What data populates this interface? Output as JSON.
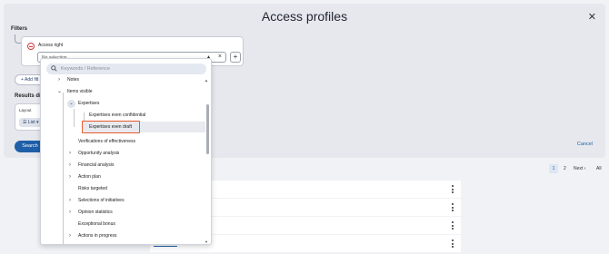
{
  "modal": {
    "title": "Access profiles",
    "close_icon": "close-icon"
  },
  "filters": {
    "label": "Filters",
    "access_right_label": "Access right",
    "select_placeholder": "No selection",
    "add_filter_label": "+ Add filt",
    "plus_label": "+"
  },
  "results": {
    "label": "Results disp",
    "layout_label": "Layout",
    "list_label": "☰ List ▾"
  },
  "buttons": {
    "search": "Search",
    "cancel": "Cancel"
  },
  "pagination": {
    "current": "1",
    "page2": "2",
    "next": "Next ›",
    "all": "All"
  },
  "dropdown": {
    "search_placeholder": "Keywords / Reference",
    "items": [
      {
        "label": "Notes"
      },
      {
        "label": "Items visible"
      },
      {
        "label": "Expertises"
      },
      {
        "label": "Expertises even confidential"
      },
      {
        "label": "Expertises even draft"
      },
      {
        "label": "Verifications of effectiveness"
      },
      {
        "label": "Opportunity analysis"
      },
      {
        "label": "Financial analysis"
      },
      {
        "label": "Action plan"
      },
      {
        "label": "Risks targeted"
      },
      {
        "label": "Selections of initiatives"
      },
      {
        "label": "Opinion statistics"
      },
      {
        "label": "Exceptional bonus"
      },
      {
        "label": "Actions in progress"
      }
    ]
  },
  "result_rows": {
    "partial_link": "Global draft"
  },
  "colors": {
    "primary": "#1e5fa8",
    "highlight": "#e8592b",
    "remove": "#d23a3a"
  }
}
